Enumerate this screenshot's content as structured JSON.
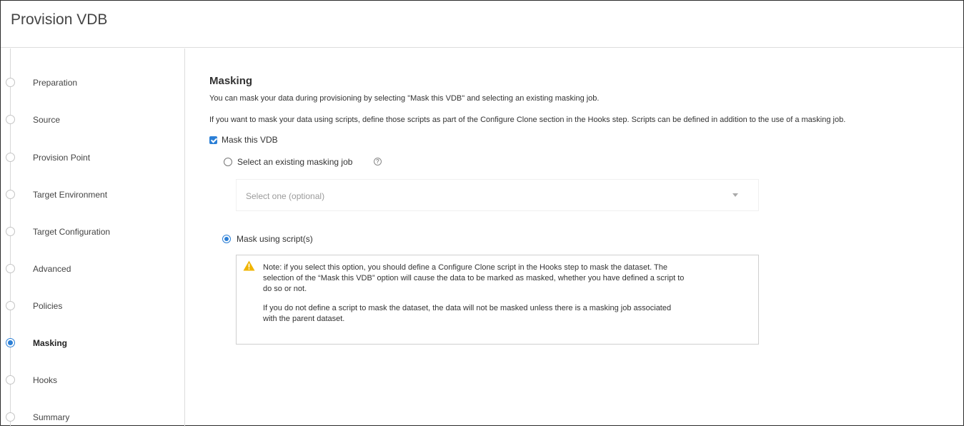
{
  "window": {
    "title": "Provision VDB"
  },
  "steps": [
    {
      "label": "Preparation",
      "active": false
    },
    {
      "label": "Source",
      "active": false
    },
    {
      "label": "Provision Point",
      "active": false
    },
    {
      "label": "Target Environment",
      "active": false
    },
    {
      "label": "Target Configuration",
      "active": false
    },
    {
      "label": "Advanced",
      "active": false
    },
    {
      "label": "Policies",
      "active": false
    },
    {
      "label": "Masking",
      "active": true
    },
    {
      "label": "Hooks",
      "active": false
    },
    {
      "label": "Summary",
      "active": false
    }
  ],
  "masking": {
    "title": "Masking",
    "desc1": "You can mask your data during provisioning by selecting \"Mask this VDB\" and selecting an existing masking job.",
    "desc2": "If you want to mask your data using scripts, define those scripts as part of the Configure Clone section in the Hooks step. Scripts can be defined in addition to the use of a masking job.",
    "mask_vdb_label": "Mask this VDB",
    "mask_vdb_checked": true,
    "existing_job_label": "Select an existing masking job",
    "existing_job_selected": false,
    "select_placeholder": "Select one (optional)",
    "script_label": "Mask using script(s)",
    "script_selected": true,
    "note_para1_line1": "Note: if you select this option, you should define a Configure Clone script in the Hooks step to mask the dataset. The",
    "note_para1_line2": "selection of the “Mask this VDB” option will cause the data to be marked as masked, whether you have defined a script to",
    "note_para1_line3": "do so or not.",
    "note_para2_line1": "If you do not define a script to mask the dataset, the data will not be masked unless there is a masking job associated",
    "note_para2_line2": "with the parent dataset."
  },
  "colors": {
    "accent": "#2b7fd6",
    "warning": "#f0b400",
    "border": "#dddddd"
  },
  "icons": {
    "help": "help-circle-icon",
    "warning": "warning-triangle-icon",
    "checkbox": "checkbox-checked-icon"
  }
}
